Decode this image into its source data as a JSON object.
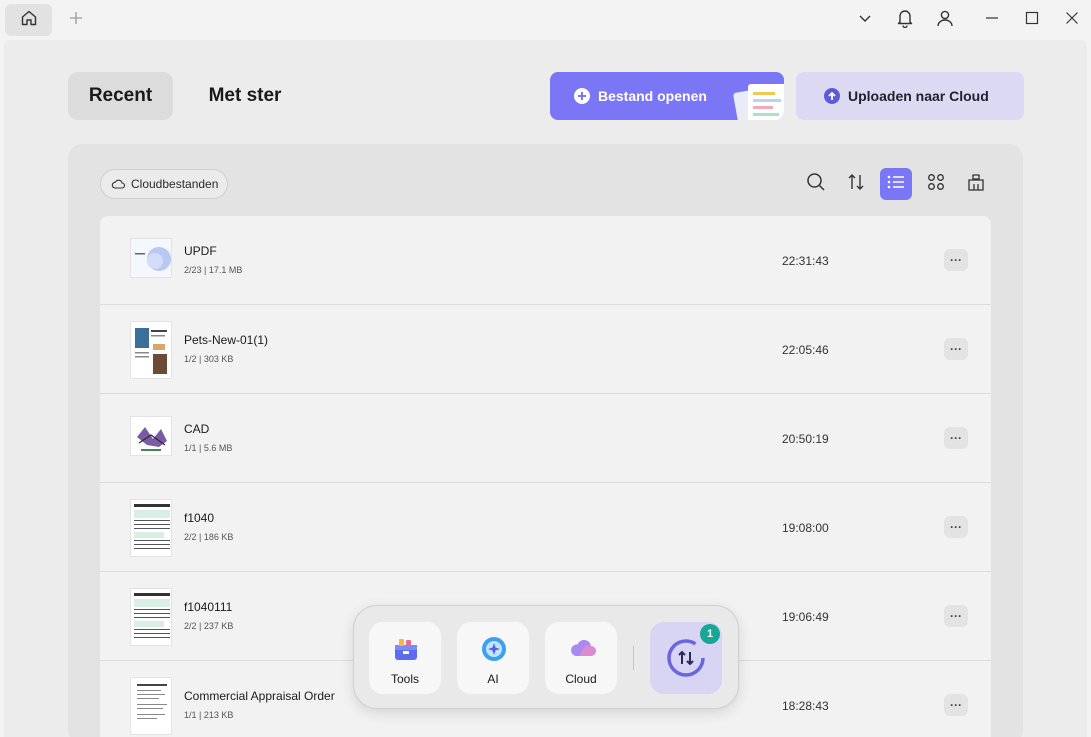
{
  "titlebar": {
    "home_icon": "home-icon",
    "new_tab_icon": "plus-icon",
    "dropdown_icon": "chevron-down-icon",
    "notifications_icon": "bell-icon",
    "account_icon": "user-icon",
    "minimize_icon": "minimize-icon",
    "maximize_icon": "maximize-icon",
    "close_icon": "close-icon"
  },
  "tabs": {
    "recent": "Recent",
    "starred": "Met ster"
  },
  "actions": {
    "open_file": "Bestand openen",
    "upload_cloud": "Uploaden naar Cloud"
  },
  "toolbar": {
    "cloud_files": "Cloudbestanden",
    "icons": [
      "search-icon",
      "sort-icon",
      "list-view-icon",
      "grid-view-icon",
      "clean-icon"
    ]
  },
  "files": [
    {
      "name": "UPDF",
      "meta": "2/23 | 17.1 MB",
      "time": "22:31:43",
      "more": "···"
    },
    {
      "name": "Pets-New-01(1)",
      "meta": "1/2 | 303 KB",
      "time": "22:05:46",
      "more": "···"
    },
    {
      "name": "CAD",
      "meta": "1/1 | 5.6 MB",
      "time": "20:50:19",
      "more": "···"
    },
    {
      "name": "f1040",
      "meta": "2/2 | 186 KB",
      "time": "19:08:00",
      "more": "···"
    },
    {
      "name": "f1040111",
      "meta": "2/2 | 237 KB",
      "time": "19:06:49",
      "more": "···"
    },
    {
      "name": "Commercial Appraisal Order",
      "meta": "1/1 | 213 KB",
      "time": "18:28:43",
      "more": "···"
    }
  ],
  "dock": {
    "tools": "Tools",
    "ai": "AI",
    "cloud": "Cloud",
    "sync_badge": "1"
  },
  "colors": {
    "accent": "#7a76f5",
    "accent_light": "#dcdaf3",
    "badge": "#17a697"
  }
}
